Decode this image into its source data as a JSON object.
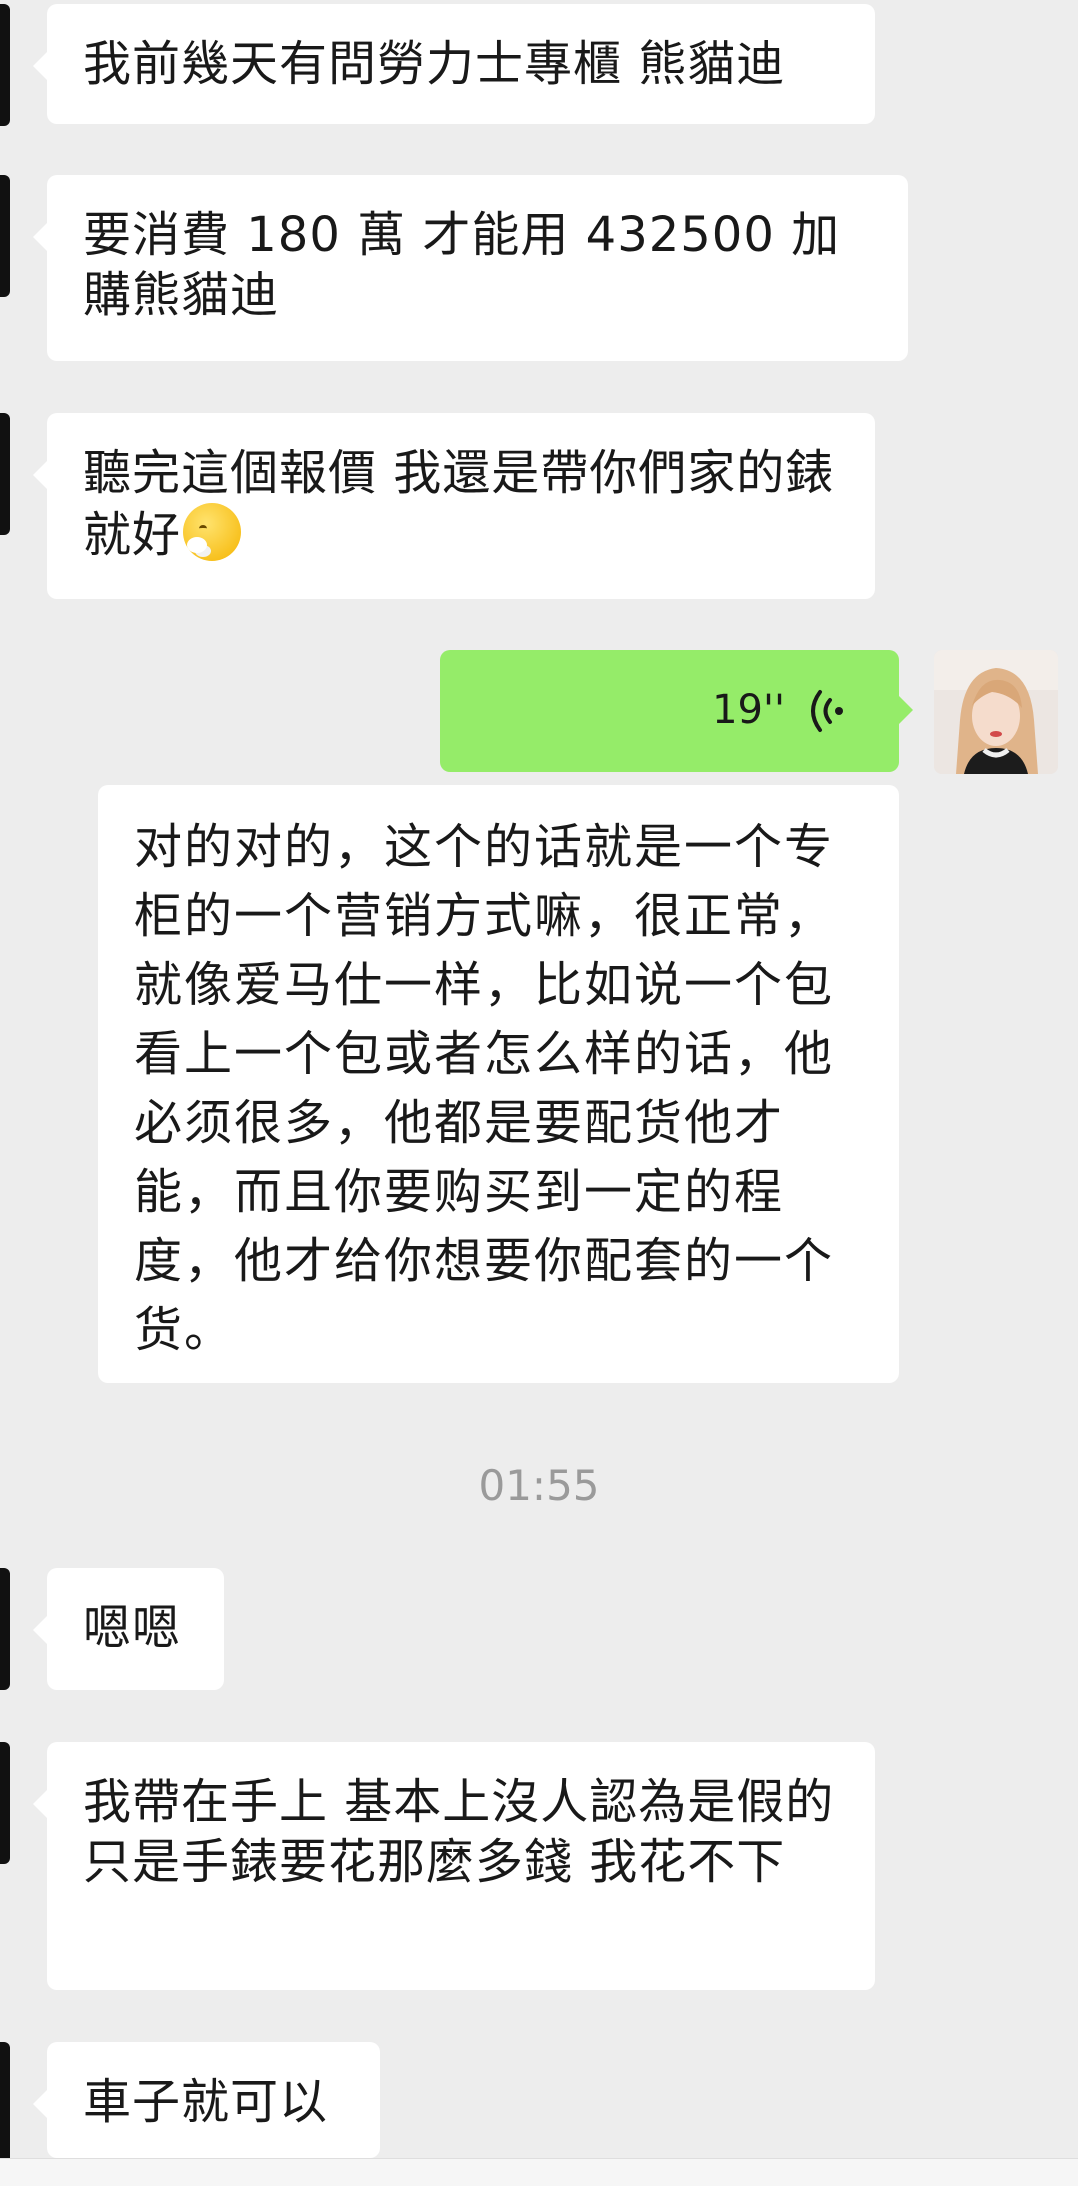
{
  "messages": {
    "m1": "我前幾天有問勞力士專櫃  熊貓迪",
    "m2": "要消費 180 萬  才能用 432500 加購熊貓迪",
    "m3": "聽完這個報價  我還是帶你們家的錶就好",
    "m3_emoji": "face-with-steam-emoji",
    "voice_duration": "19''",
    "voice_icon": "voice-wave-icon",
    "transcript": "对的对的，这个的话就是一个专柜的一个营销方式嘛，很正常，就像爱马仕一样，比如说一个包看上一个包或者怎么样的话，他必须很多，他都是要配货他才能，而且你要购买到一定的程度，他才给你想要你配套的一个货。",
    "time": "01:55",
    "m4": "嗯嗯",
    "m5": "我帶在手上 基本上沒人認為是假的    只是手錶要花那麼多錢  我花不下",
    "m6": "車子就可以"
  },
  "colors": {
    "background": "#ededed",
    "incoming_bubble": "#ffffff",
    "outgoing_bubble": "#95ec69",
    "timestamp_text": "#9a9a9a"
  }
}
